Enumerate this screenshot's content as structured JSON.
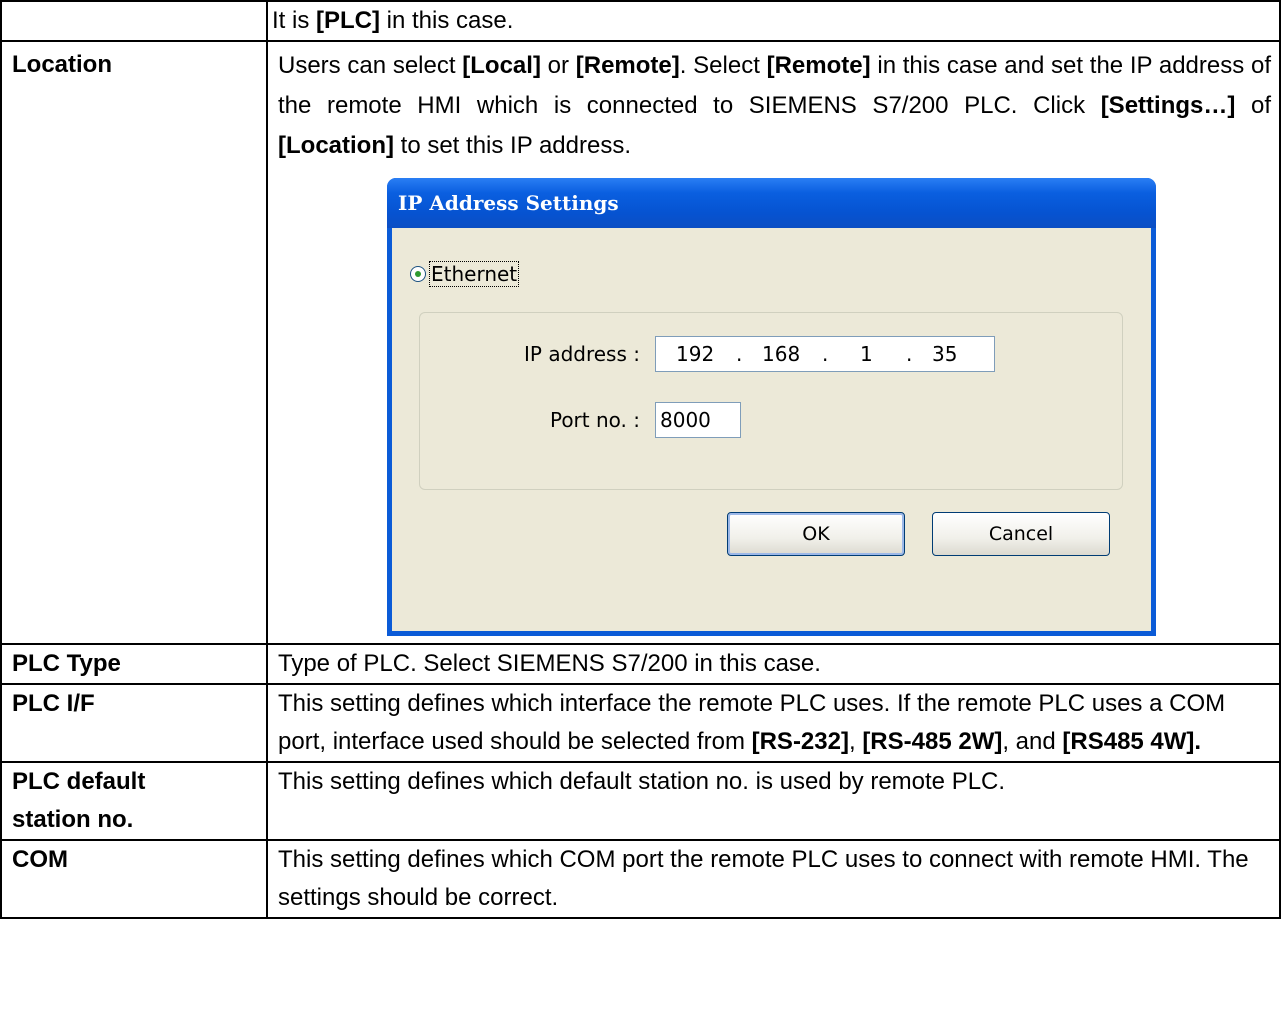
{
  "row_top": {
    "label": "",
    "desc_prefix": "It is ",
    "desc_bold": "[PLC]",
    "desc_suffix": " in this case."
  },
  "location": {
    "label": "Location",
    "t1": "Users can select ",
    "b1": "[Local]",
    "t2": " or ",
    "b2": "[Remote]",
    "t3": ". Select ",
    "b3": "[Remote]",
    "t4": " in this case and set the IP address of the remote HMI which is connected to SIEMENS S7/200 PLC. Click ",
    "b4": "[Settings…]",
    "t5": " of ",
    "b5": "[Location]",
    "t6": " to set this IP address."
  },
  "dialog": {
    "title": "IP Address Settings",
    "radio_label": "Ethernet",
    "ip_label": "IP address :",
    "ip_octets": [
      "192",
      "168",
      "1",
      "35"
    ],
    "ip_dot": ".",
    "port_label": "Port no. :",
    "port_value": "8000",
    "ok_label": "OK",
    "cancel_label": "Cancel"
  },
  "plc_type": {
    "label": "PLC Type",
    "desc": "Type of PLC. Select SIEMENS S7/200 in this case."
  },
  "plc_if": {
    "label": "PLC I/F",
    "t1": "This setting defines which interface the remote PLC uses. If the remote PLC uses a COM port, interface used should be selected from ",
    "b1": "[RS-232]",
    "t2": ", ",
    "b2": "[RS-485 2W]",
    "t3": ", and ",
    "b3": "[RS485 4W]."
  },
  "plc_station": {
    "label_line1": "PLC default",
    "label_line2": "station no.",
    "desc": "This setting defines which default station no. is used by remote PLC."
  },
  "com": {
    "label": "COM",
    "desc": "This setting defines which COM port the remote PLC uses to connect with remote HMI. The settings should be correct."
  }
}
